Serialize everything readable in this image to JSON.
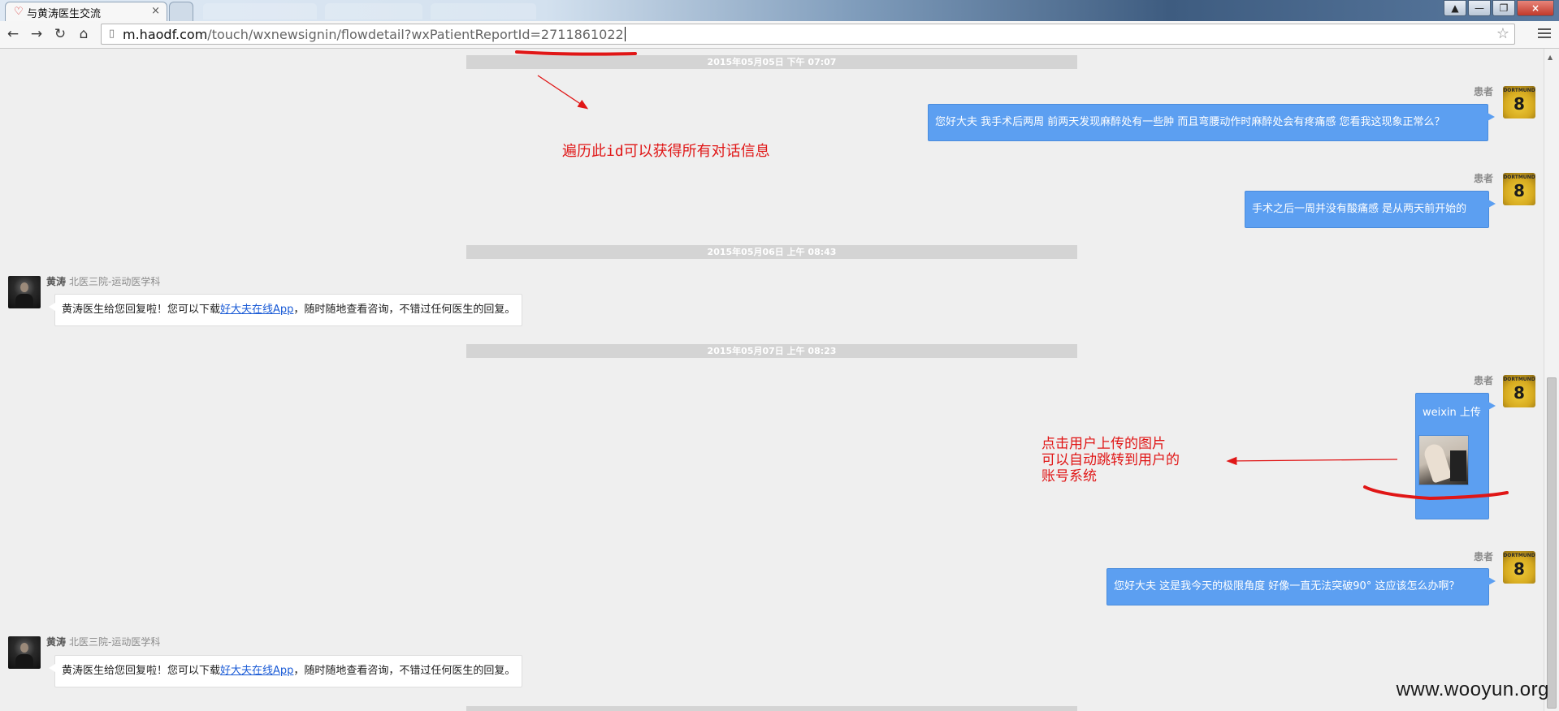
{
  "browser": {
    "active_tab_title": "与黄涛医生交流",
    "close_glyph": "×",
    "url_domain": "m.haodf.com",
    "url_path": "/touch/wxnewsignin/flowdetail?wxPatientReportId=2711861022"
  },
  "chat": {
    "timestamps": [
      "2015年05月05日 下午 07:07",
      "2015年05月06日 上午 08:43",
      "2015年05月07日 上午 08:23"
    ],
    "patient_label": "患者",
    "doctor_name": "黄涛",
    "doctor_dept": "北医三院-运动医学科",
    "avatar_number": "8",
    "avatar_shirt_text": "DORTMUND",
    "patient_messages": [
      "您好大夫 我手术后两周 前两天发现麻醉处有一些肿 而且弯腰动作时麻醉处会有疼痛感 您看我这现象正常么？",
      "手术之后一周并没有酸痛感 是从两天前开始的",
      "weixin 上传",
      "您好大夫 这是我今天的极限角度 好像一直无法突破90° 这应该怎么办啊？"
    ],
    "doctor_reply": {
      "before": "黄涛医生给您回复啦！您可以下载",
      "link": "好大夫在线App",
      "after": "，随时随地查看咨询，不错过任何医生的回复。"
    }
  },
  "annotations": {
    "id_note": "遍历此id可以获得所有对话信息",
    "image_note": [
      "点击用户上传的图片",
      "可以自动跳转到用户的",
      "账号系统"
    ],
    "color": "#e01616"
  },
  "watermark": "www.wooyun.org"
}
